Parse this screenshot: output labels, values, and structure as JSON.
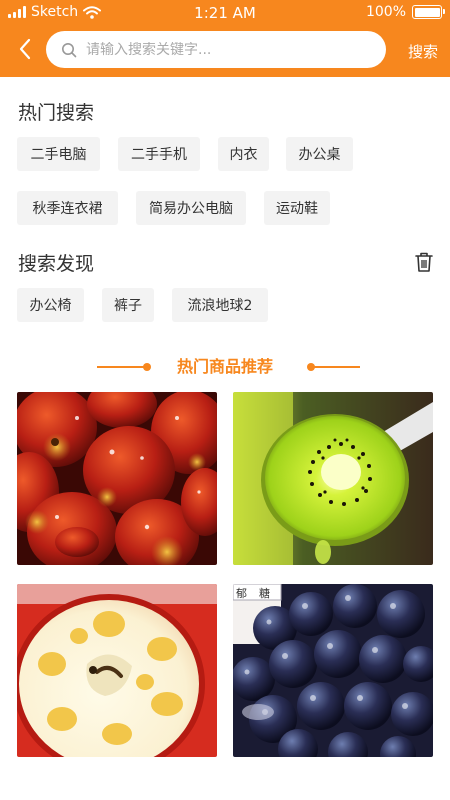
{
  "status_bar": {
    "carrier": "Sketch",
    "time": "1:21 AM",
    "battery": "100%",
    "battery_level": 1.0
  },
  "header": {
    "back_icon": "chevron-left-icon",
    "search_placeholder": "请输入搜索关键字...",
    "search_button": "搜索",
    "accent_color": "#f7871e"
  },
  "hot_search": {
    "title": "热门搜索",
    "tags": [
      "二手电脑",
      "二手手机",
      "内衣",
      "办公桌",
      "秋季连衣裙",
      "简易办公电脑",
      "运动鞋"
    ]
  },
  "discover": {
    "title": "搜索发现",
    "delete_icon": "trash-icon",
    "tags": [
      "办公椅",
      "裤子",
      "流浪地球2"
    ]
  },
  "recommend": {
    "title": "热门商品推荐",
    "products": [
      {
        "image": "red-jujubes-photo"
      },
      {
        "image": "kiwi-slice-photo"
      },
      {
        "image": "apple-cross-section-photo"
      },
      {
        "image": "grapes-photo",
        "label_chars": [
          "郁",
          "糖"
        ]
      }
    ]
  }
}
